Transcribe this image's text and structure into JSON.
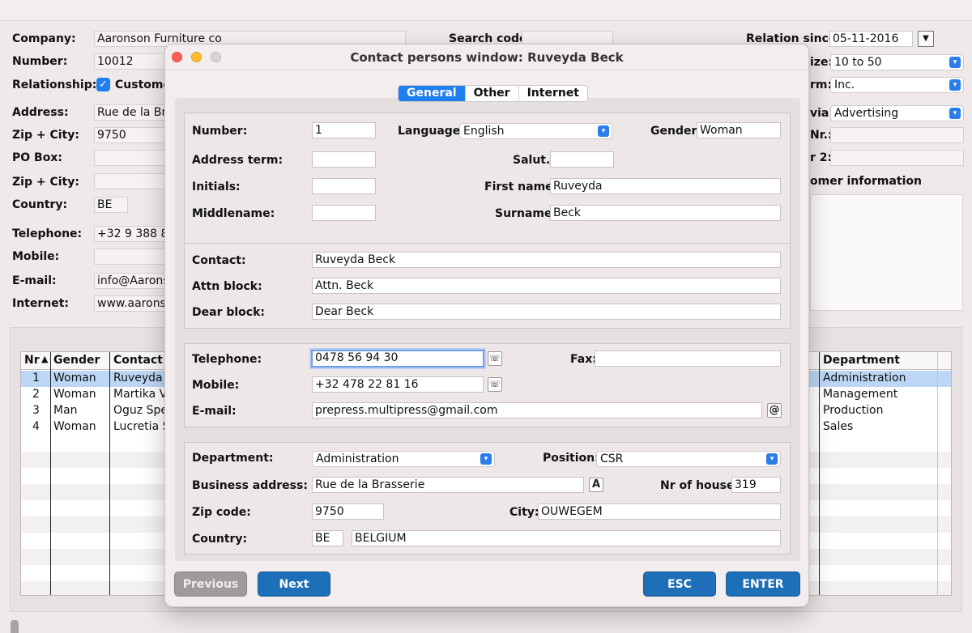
{
  "background": {
    "left_labels": {
      "company": "Company:",
      "number": "Number:",
      "relationship": "Relationship:",
      "address": "Address:",
      "zip_city": "Zip + City:",
      "po_box": "PO Box:",
      "zip_city_2": "Zip + City:",
      "country": "Country:",
      "telephone": "Telephone:",
      "mobile": "Mobile:",
      "email": "E-mail:",
      "internet": "Internet:"
    },
    "left_values": {
      "company": "Aaronson Furniture co",
      "number": "10012",
      "relationship_checkbox_label": "Custome",
      "address": "Rue de la Bra",
      "zip_city": "9750",
      "country": "BE",
      "telephone": "+32 9 388 8",
      "email": "info@Aarons",
      "internet": "www.aaronso"
    },
    "search_code_label": "Search code:",
    "relation_since_label": "Relation since:",
    "relation_since_value": "05-11-2016",
    "right_labels": {
      "size": "ize:",
      "term": "rm:",
      "via": "via:",
      "nr": "Nr.:",
      "r2": "r 2:",
      "customer_info": "omer information"
    },
    "right_values": {
      "size": "10 to 50",
      "term": "Inc.",
      "via": "Advertising"
    },
    "table": {
      "headers": {
        "nr": "Nr",
        "gender": "Gender",
        "contact": "Contact p",
        "department": "Department"
      },
      "rows": [
        {
          "nr": "1",
          "gender": "Woman",
          "contact": "Ruveyda E",
          "department": "Administration"
        },
        {
          "nr": "2",
          "gender": "Woman",
          "contact": "Martika V",
          "department": "Management"
        },
        {
          "nr": "3",
          "gender": "Man",
          "contact": "Oguz Spe",
          "department": "Production"
        },
        {
          "nr": "4",
          "gender": "Woman",
          "contact": "Lucretia S",
          "department": "Sales"
        }
      ]
    }
  },
  "modal": {
    "title": "Contact persons window: Ruveyda Beck",
    "tabs": [
      "General",
      "Other",
      "Internet"
    ],
    "active_tab": "General",
    "section1": {
      "number_label": "Number:",
      "number_value": "1",
      "language_label": "Language:",
      "language_value": "English",
      "gender_label": "Gender:",
      "gender_value": "Woman",
      "address_term_label": "Address term:",
      "address_term_value": "",
      "salut_label": "Salut.:",
      "salut_value": "",
      "initials_label": "Initials:",
      "initials_value": "",
      "first_name_label": "First name:",
      "first_name_value": "Ruveyda",
      "middlename_label": "Middlename:",
      "middlename_value": "",
      "surname_label": "Surname:",
      "surname_value": "Beck"
    },
    "section2": {
      "contact_label": "Contact:",
      "contact_value": "Ruveyda Beck",
      "attn_label": "Attn block:",
      "attn_value": "Attn. Beck",
      "dear_label": "Dear block:",
      "dear_value": "Dear Beck"
    },
    "section3": {
      "telephone_label": "Telephone:",
      "telephone_value": "0478 56 94 30",
      "fax_label": "Fax:",
      "fax_value": "",
      "mobile_label": "Mobile:",
      "mobile_value": "+32 478 22 81 16",
      "email_label": "E-mail:",
      "email_value": "prepress.multipress@gmail.com"
    },
    "section4": {
      "department_label": "Department:",
      "department_value": "Administration",
      "position_label": "Position:",
      "position_value": "CSR",
      "business_address_label": "Business address:",
      "business_address_value": "Rue de la Brasserie",
      "nr_of_house_label": "Nr of house:",
      "nr_of_house_value": "319",
      "zip_label": "Zip code:",
      "zip_value": "9750",
      "city_label": "City:",
      "city_value": "OUWEGEM",
      "country_label": "Country:",
      "country_code": "BE",
      "country_name": "BELGIUM"
    },
    "buttons": {
      "previous": "Previous",
      "next": "Next",
      "esc": "ESC",
      "enter": "ENTER"
    },
    "icon_glyphs": {
      "phone": "☏",
      "address": "A",
      "email": "@"
    },
    "colors": {
      "accent": "#1f7ef0",
      "button": "#1d6fb8",
      "selection": "#bcd7f5"
    }
  }
}
